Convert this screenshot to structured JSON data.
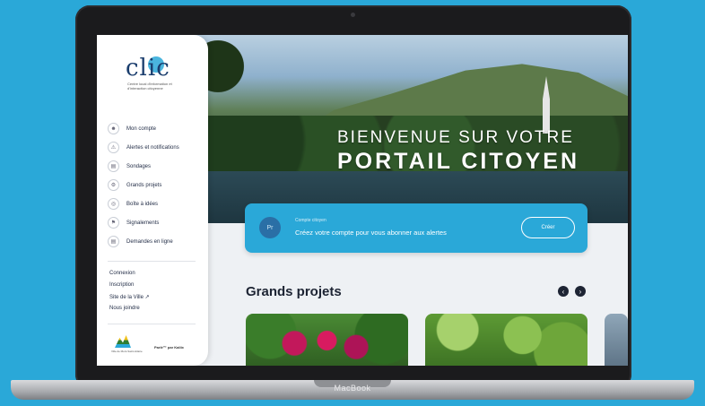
{
  "laptop": {
    "brand": "MacBook"
  },
  "sidebar": {
    "logo": {
      "text": "clic",
      "subtitle": "Centre local d'information et d'interaction citoyenne"
    },
    "nav": [
      {
        "label": "Mon compte",
        "icon": "user-icon"
      },
      {
        "label": "Alertes et notifications",
        "icon": "alert-icon"
      },
      {
        "label": "Sondages",
        "icon": "survey-icon"
      },
      {
        "label": "Grands projets",
        "icon": "projects-icon"
      },
      {
        "label": "Boîte à idées",
        "icon": "idea-icon"
      },
      {
        "label": "Signalements",
        "icon": "flag-icon"
      },
      {
        "label": "Demandes en ligne",
        "icon": "request-icon"
      }
    ],
    "links": [
      "Connexion",
      "Inscription",
      "Site de la Ville ↗",
      "Nous joindre"
    ],
    "footer": {
      "city_caption": "Ville de Mont-Saint-Hilaire",
      "signature": "Parlé™ par Kaliix"
    }
  },
  "hero": {
    "title_line1": "BIENVENUE SUR VOTRE",
    "title_line2": "PORTAIL CITOYEN"
  },
  "banner": {
    "avatar_initials": "Pr",
    "small_text": "Compte citoyen",
    "main_text": "Créez votre compte pour vous abonner aux alertes",
    "button_label": "Créer"
  },
  "projects": {
    "title": "Grands projets"
  },
  "colors": {
    "accent": "#2aa8d8",
    "navy": "#1a3d6d"
  }
}
